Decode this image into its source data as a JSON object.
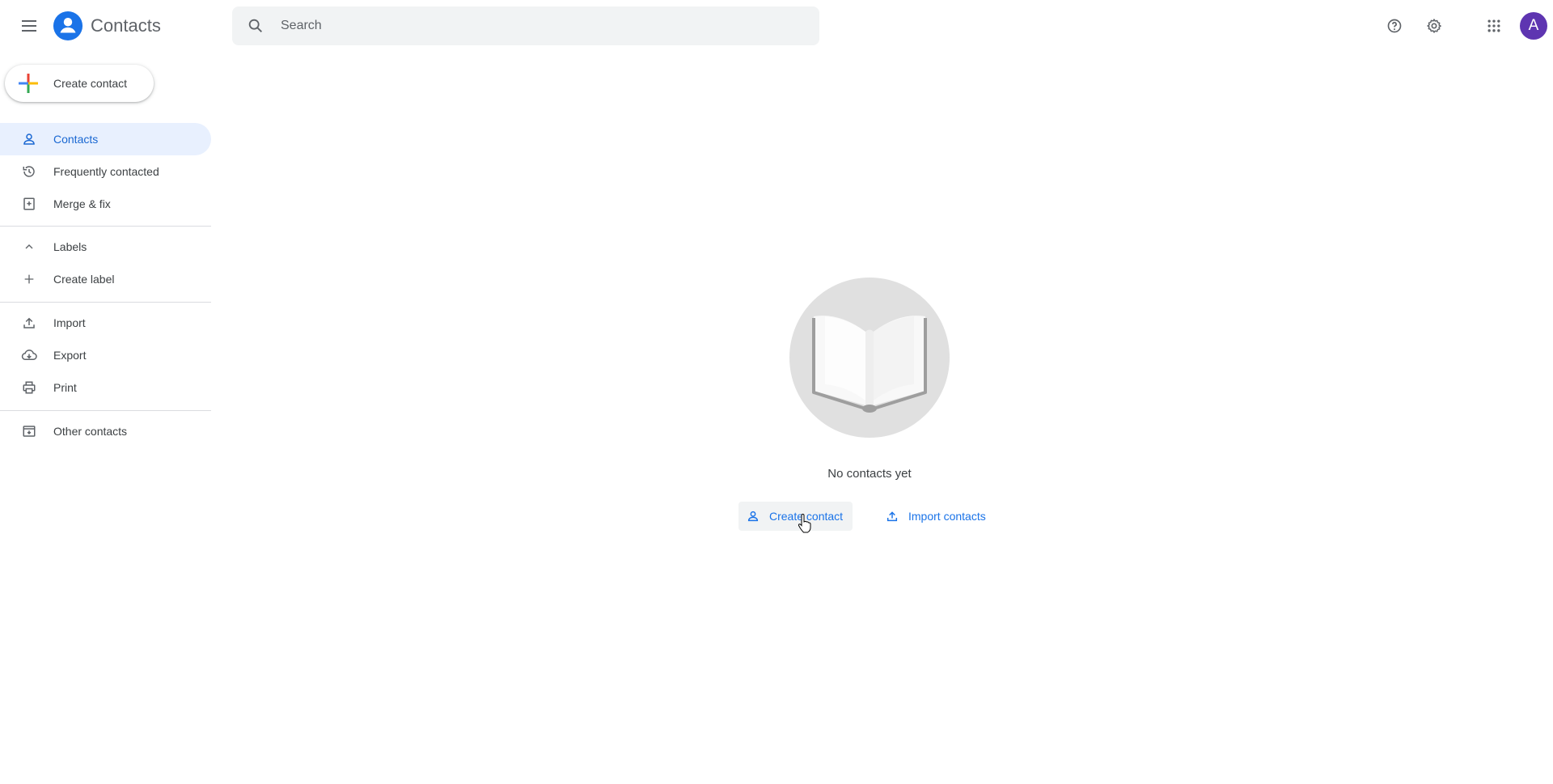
{
  "header": {
    "app_title": "Contacts",
    "search_placeholder": "Search",
    "search_value": "",
    "avatar_letter": "A",
    "avatar_color": "#5e35b1",
    "icons": [
      "menu-icon",
      "contacts-logo-icon",
      "search-icon",
      "help-icon",
      "settings-icon",
      "apps-grid-icon"
    ]
  },
  "sidebar": {
    "create_label": "Create contact",
    "items": [
      {
        "label": "Contacts",
        "icon": "person-icon",
        "active": true
      },
      {
        "label": "Frequently contacted",
        "icon": "history-icon"
      },
      {
        "label": "Merge & fix",
        "icon": "merge-fix-icon"
      }
    ],
    "labels_section": {
      "label": "Labels",
      "icon": "chevron-up-icon",
      "create_label": "Create label"
    },
    "tools": [
      {
        "label": "Import",
        "icon": "upload-icon"
      },
      {
        "label": "Export",
        "icon": "cloud-download-icon"
      },
      {
        "label": "Print",
        "icon": "printer-icon"
      }
    ],
    "other_contacts": {
      "label": "Other contacts",
      "icon": "archive-icon"
    }
  },
  "main": {
    "empty_message": "No contacts yet",
    "create_contact_label": "Create contact",
    "import_contacts_label": "Import contacts"
  },
  "colors": {
    "accent": "#1a73e8",
    "active_bg": "#e8f0fe",
    "active_text": "#1967d2"
  }
}
